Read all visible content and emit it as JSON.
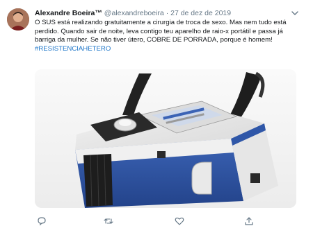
{
  "tweet": {
    "author_name": "Alexandre Boeira™",
    "handle": "@alexandreboeira",
    "separator": "·",
    "date": "27 de dez de 2019",
    "text": "O SUS está realizando gratuitamente a cirurgia de troca de sexo. Mas nem tudo está perdido. Quando sair de noite, leva contigo teu aparelho de raio-x portátil e passa já barriga da mulher. Se não tiver útero, COBRE DE PORRADA, porque é homem!",
    "hashtag": "#RESISTENCIAHETERO",
    "media_icon": "portable-x-ray-device-photo"
  },
  "actions": {
    "icons": [
      "reply-icon",
      "retweet-icon",
      "like-icon",
      "share-icon"
    ]
  },
  "colors": {
    "link": "#1b74c8",
    "secondary_text": "#657786",
    "device_blue": "#2f57a8"
  }
}
